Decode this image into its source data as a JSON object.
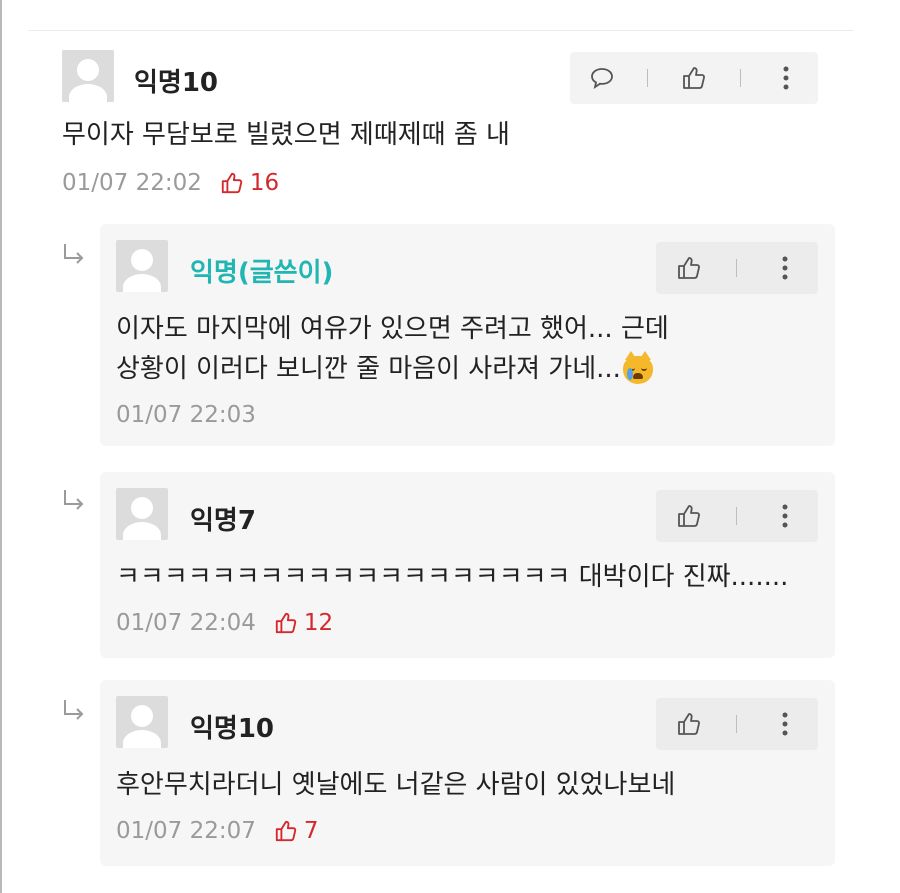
{
  "comments": [
    {
      "nick": "익명10",
      "text": [
        "무이자 무담보로 빌렸으면 제때제때 좀 내"
      ],
      "time": "01/07 22:02",
      "likes": "16"
    },
    {
      "nick": "익명(글쓴이)",
      "text": [
        "이자도 마지막에 여유가 있으면 주려고 했어... 근데",
        "상황이 이러다 보니깐 줄 마음이 사라져 가네..."
      ],
      "emoji": "crying-cat-emoji",
      "time": "01/07 22:03"
    },
    {
      "nick": "익명7",
      "text": [
        "ㅋㅋㅋㅋㅋㅋㅋㅋㅋㅋㅋㅋㅋㅋㅋㅋㅋㅋㅋ 대박이다 진짜......."
      ],
      "time": "01/07 22:04",
      "likes": "12"
    },
    {
      "nick": "익명10",
      "text": [
        "후안무치라더니 옛날에도 너같은 사람이 있었나보네"
      ],
      "time": "01/07 22:07",
      "likes": "7"
    }
  ],
  "icons": {
    "reply": "speech-bubble-icon",
    "like": "thumbs-up-icon",
    "more": "more-vertical-icon",
    "reply_indicator": "reply-arrow-icon"
  },
  "colors": {
    "writer_nick": "#21b5b3",
    "likes": "#d4282c",
    "meta": "#9a9a9a",
    "reply_bg": "#f6f6f6"
  }
}
